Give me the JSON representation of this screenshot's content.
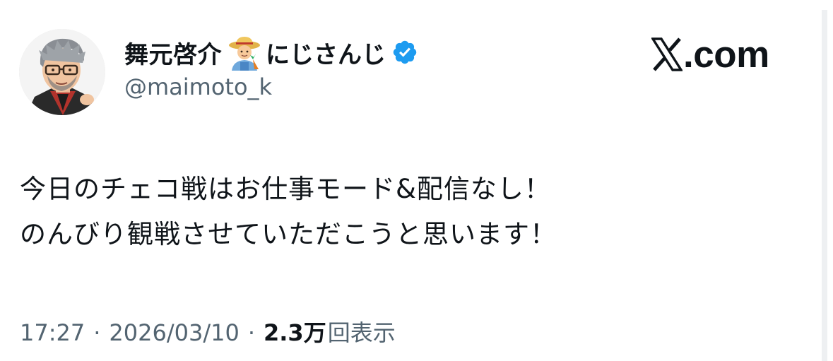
{
  "profile": {
    "display_name_part1": "舞元啓介",
    "display_name_part2": "にじさんじ",
    "handle": "@maimoto_k",
    "verified_color": "#1d9bf0"
  },
  "brand": {
    "label": ".com"
  },
  "tweet": {
    "text": "今日のチェコ戦はお仕事モード&配信なし！\nのんびり観戦させていただこうと思います！"
  },
  "meta": {
    "time": "17:27",
    "separator": "·",
    "date": "2026/03/10",
    "views_count": "2.3万",
    "views_label": "回表示"
  },
  "icons": {
    "avatar": "avatar-image",
    "emoji": "farmer-emoji-icon",
    "verified": "verified-badge-icon",
    "brand": "x-logo-icon"
  }
}
